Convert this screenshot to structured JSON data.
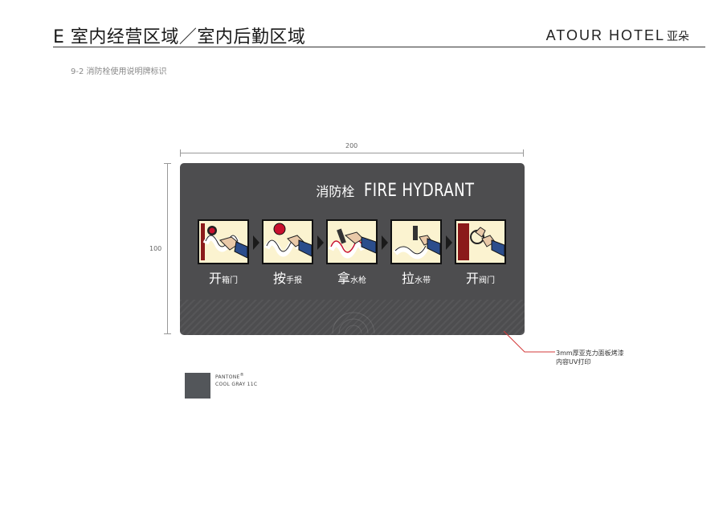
{
  "header": {
    "title": "E 室内经营区域／室内后勤区域",
    "brand_en": "ATOUR HOTEL",
    "brand_cn": "亚朵"
  },
  "section_label": "9-2  消防栓使用说明牌标识",
  "dimensions": {
    "width_label": "200",
    "height_label": "100"
  },
  "sign": {
    "title_cn": "消防栓",
    "title_en": "FIRE HYDRANT",
    "steps": [
      {
        "big": "开",
        "small": "箱门",
        "icon": "open-cabinet-door-icon"
      },
      {
        "big": "按",
        "small": "手报",
        "icon": "press-alarm-button-icon"
      },
      {
        "big": "拿",
        "small": "水枪",
        "icon": "take-nozzle-icon"
      },
      {
        "big": "拉",
        "small": "水带",
        "icon": "pull-hose-icon"
      },
      {
        "big": "开",
        "small": "阀门",
        "icon": "open-valve-icon"
      }
    ],
    "colors": {
      "panel": "#4d4d4f",
      "step_bg": "#fbf3d0",
      "accent_red": "#c8102e",
      "glove_blue": "#2b4d8c"
    }
  },
  "annotation": {
    "line1": "3mm厚亚克力面板烤漆",
    "line2": "内容UV打印",
    "line_color": "#d33a3a"
  },
  "swatch": {
    "brand": "PANTONE",
    "mark": "®",
    "name": "COOL GRAY 11C",
    "color": "#53565a"
  }
}
